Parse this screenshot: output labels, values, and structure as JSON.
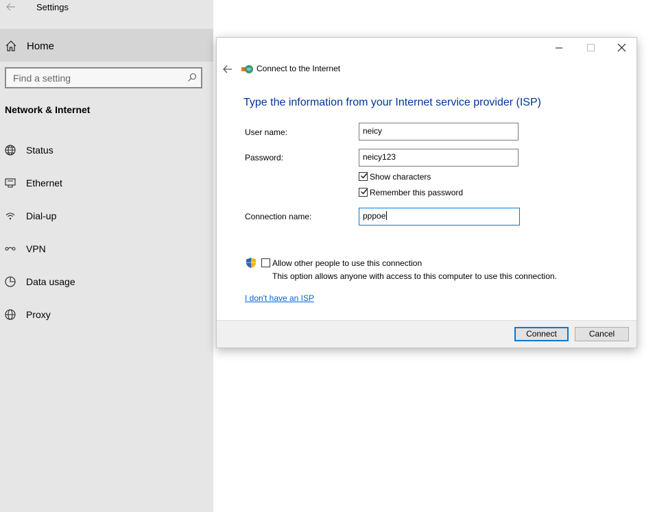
{
  "settings": {
    "title": "Settings",
    "home_label": "Home",
    "search_placeholder": "Find a setting",
    "section_title": "Network & Internet",
    "nav_items": [
      {
        "label": "Status",
        "icon": "globe-status-icon"
      },
      {
        "label": "Ethernet",
        "icon": "ethernet-icon"
      },
      {
        "label": "Dial-up",
        "icon": "dialup-icon"
      },
      {
        "label": "VPN",
        "icon": "vpn-icon"
      },
      {
        "label": "Data usage",
        "icon": "data-usage-icon"
      },
      {
        "label": "Proxy",
        "icon": "globe-proxy-icon"
      }
    ]
  },
  "dialog": {
    "title": "Connect to the Internet",
    "heading": "Type the information from your Internet service provider (ISP)",
    "fields": {
      "username_label": "User name:",
      "username_value": "neicy",
      "password_label": "Password:",
      "password_value": "neicy123",
      "connection_label": "Connection name:",
      "connection_value": "pppoe"
    },
    "checkboxes": {
      "show_characters": {
        "label": "Show characters",
        "checked": true
      },
      "remember_password": {
        "label": "Remember this password",
        "checked": true
      },
      "allow_others": {
        "label": "Allow other people to use this connection",
        "checked": false
      }
    },
    "allow_info": "This option allows anyone with access to this computer to use this connection.",
    "no_isp_link": "I don't have an ISP",
    "buttons": {
      "connect": "Connect",
      "cancel": "Cancel"
    }
  },
  "colors": {
    "heading": "#003399",
    "link": "#0066cc",
    "focus": "#0078d7",
    "sidebar_bg": "#e6e6e6"
  }
}
